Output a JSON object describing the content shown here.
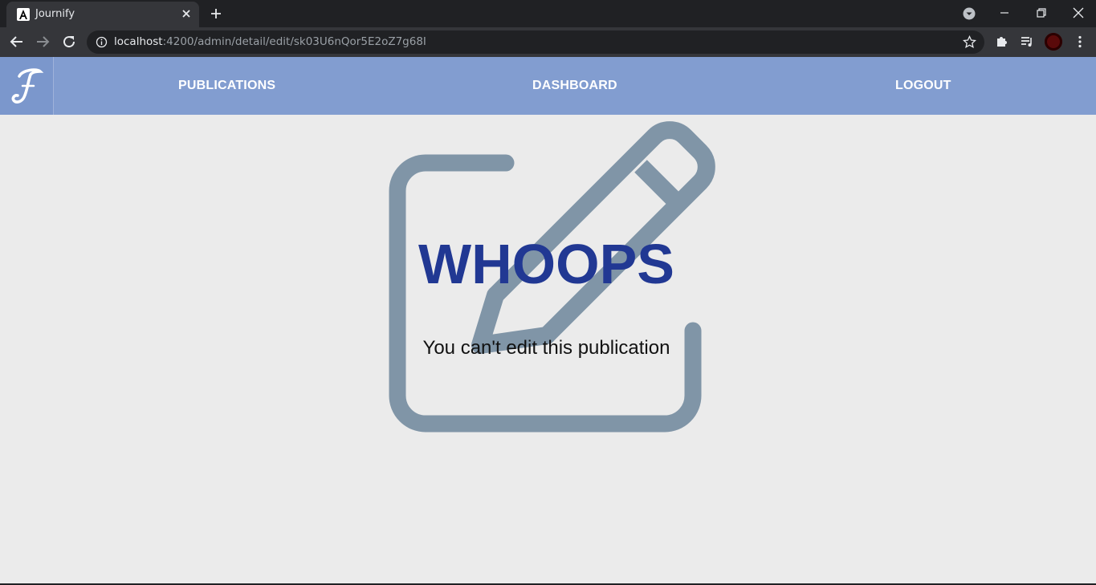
{
  "browser": {
    "tab_title": "Journify",
    "url_host": "localhost",
    "url_path": ":4200/admin/detail/edit/sk03U6nQor5E2oZ7g68I"
  },
  "header": {
    "logo_letter": "J",
    "nav": {
      "publications": "PUBLICATIONS",
      "dashboard": "DASHBOARD",
      "logout": "LOGOUT"
    }
  },
  "main": {
    "heading": "WHOOPS",
    "message": "You can't edit this publication",
    "background_icon": "edit-icon"
  },
  "colors": {
    "header_bg": "#829dd0",
    "heading": "#213893",
    "icon": "#8095a7",
    "page_bg": "#ebebeb"
  }
}
